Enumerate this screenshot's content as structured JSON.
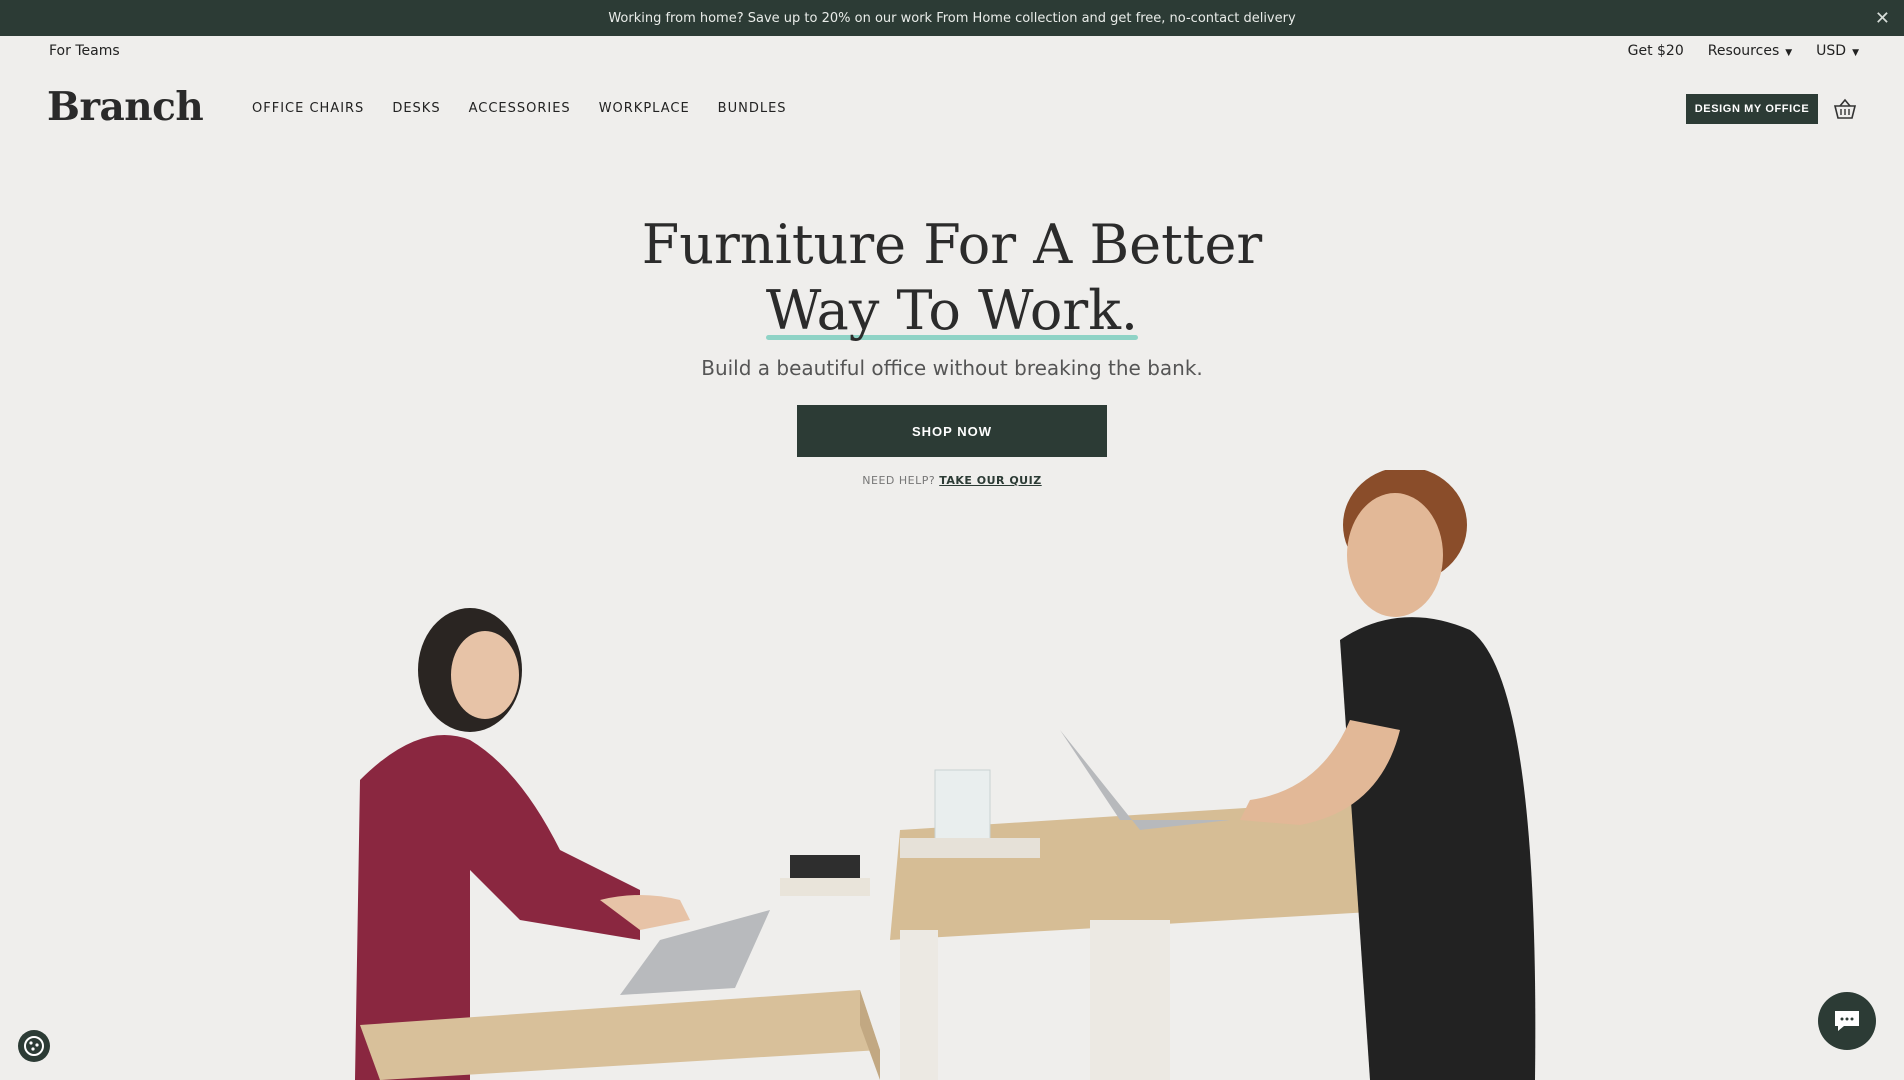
{
  "announcement": {
    "text": "Working from home? Save up to 20% on our work From Home collection and get free, no-contact delivery",
    "close_icon": "close-icon"
  },
  "utility": {
    "for_teams": "For Teams",
    "get20": "Get $20",
    "resources": "Resources",
    "currency": "USD"
  },
  "header": {
    "logo": "Branch",
    "nav": [
      "OFFICE CHAIRS",
      "DESKS",
      "ACCESSORIES",
      "WORKPLACE",
      "BUNDLES"
    ],
    "design_btn": "DESIGN MY OFFICE",
    "cart_icon": "basket-icon"
  },
  "hero": {
    "title_line1": "Furniture For A Better",
    "title_line2": "Way To Work.",
    "subtitle": "Build a beautiful office without breaking the bank.",
    "cta": "SHOP NOW",
    "help_prefix": "NEED HELP?",
    "help_link": "TAKE OUR QUIZ"
  },
  "colors": {
    "brand_dark": "#2c3b35",
    "background": "#efeeec",
    "accent_underline": "#8fd3c6"
  }
}
